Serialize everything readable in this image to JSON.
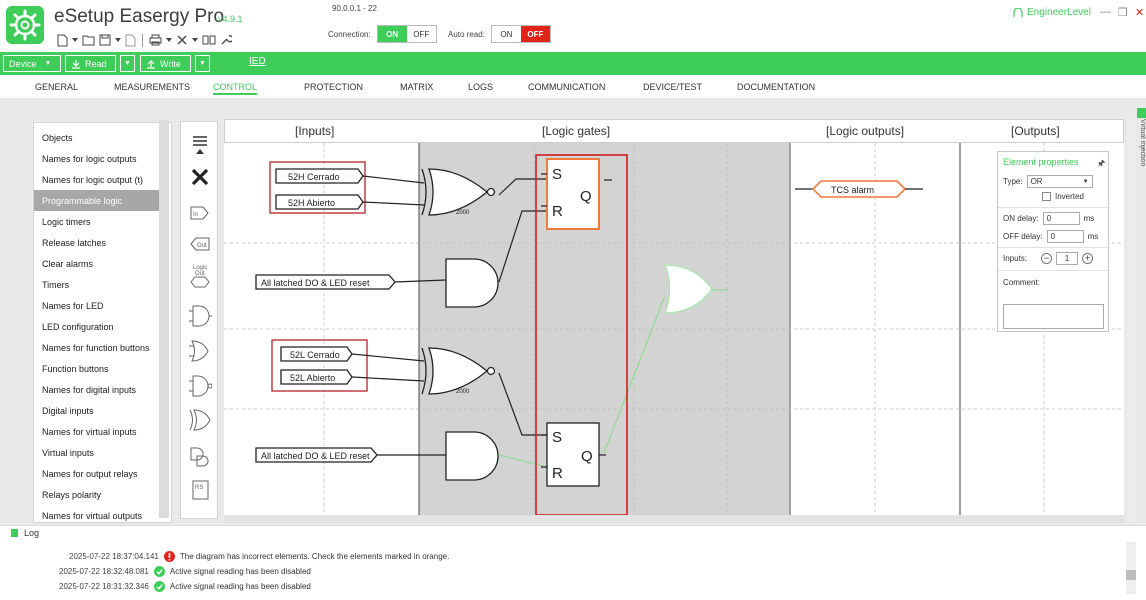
{
  "app": {
    "title": "eSetup Easergy Pro",
    "version": "v4.9.1",
    "ip_label": "90.0.0.1 - 22",
    "user_level": "EngineerLevel",
    "connection_label": "Connection:",
    "auto_read_label": "Auto read:",
    "on": "ON",
    "off": "OFF",
    "connection_state": "ON",
    "auto_read_state": "OFF"
  },
  "toolbar": {
    "device_label": "Device",
    "read_label": "Read",
    "write_label": "Write",
    "ied_label": "IED"
  },
  "tabs": [
    {
      "label": "GENERAL"
    },
    {
      "label": "MEASUREMENTS"
    },
    {
      "label": "CONTROL",
      "active": true
    },
    {
      "label": "PROTECTION"
    },
    {
      "label": "MATRIX"
    },
    {
      "label": "LOGS"
    },
    {
      "label": "COMMUNICATION"
    },
    {
      "label": "DEVICE/TEST"
    },
    {
      "label": "DOCUMENTATION"
    }
  ],
  "sidebar": {
    "items": [
      {
        "label": "Objects"
      },
      {
        "label": "Names for logic outputs"
      },
      {
        "label": "Names for logic output (t)"
      },
      {
        "label": "Programmable logic",
        "selected": true
      },
      {
        "label": "Logic timers"
      },
      {
        "label": "Release latches"
      },
      {
        "label": "Clear alarms"
      },
      {
        "label": "Timers"
      },
      {
        "label": "Names for LED"
      },
      {
        "label": "LED configuration"
      },
      {
        "label": "Names for function buttons"
      },
      {
        "label": "Function buttons"
      },
      {
        "label": "Names for digital inputs"
      },
      {
        "label": "Digital inputs"
      },
      {
        "label": "Names for virtual inputs"
      },
      {
        "label": "Virtual inputs"
      },
      {
        "label": "Names for output relays"
      },
      {
        "label": "Relays polarity"
      },
      {
        "label": "Names for virtual outputs"
      }
    ]
  },
  "palette": {
    "logic_out_label": "Logic Out",
    "in_label": "In",
    "out_label": "Out",
    "rs_label": "RS"
  },
  "canvas": {
    "columns": [
      "[Inputs]",
      "[Logic gates]",
      "[Logic outputs]",
      "[Outputs]"
    ],
    "inputs": [
      {
        "label": "52H Cerrado"
      },
      {
        "label": "52H Abierto"
      },
      {
        "label": "All latched DO & LED reset"
      },
      {
        "label": "52L Cerrado"
      },
      {
        "label": "52L Abierto"
      },
      {
        "label": "All latched DO & LED reset"
      }
    ],
    "gate_delay_1": "2000",
    "gate_delay_2": "2000",
    "flipflop_s": "S",
    "flipflop_r": "R",
    "flipflop_q": "Q",
    "logic_output": "TCS alarm"
  },
  "properties": {
    "title": "Element properties",
    "type_label": "Type:",
    "type_value": "OR",
    "inverted_label": "Inverted",
    "on_delay_label": "ON delay:",
    "on_delay_value": "0",
    "off_delay_label": "OFF delay:",
    "off_delay_value": "0",
    "unit": "ms",
    "inputs_label": "Inputs:",
    "inputs_value": "1",
    "comment_label": "Comment:"
  },
  "log": {
    "title": "Log",
    "entries": [
      {
        "timestamp": "2025-07-22 18:37:04.141",
        "status": "error",
        "message": "The diagram has incorrect elements. Check the elements marked in orange."
      },
      {
        "timestamp": "2025-07-22 18:32:48.081",
        "status": "ok",
        "message": "Active signal reading has been disabled"
      },
      {
        "timestamp": "2025-07-22 18:31:32.346",
        "status": "ok",
        "message": "Active signal reading has been disabled"
      }
    ]
  },
  "colors": {
    "brand_green": "#3dcd58",
    "error_red": "#e2231a",
    "highlight_orange": "#f07a3c",
    "annotation_red": "#cc1f1f"
  }
}
